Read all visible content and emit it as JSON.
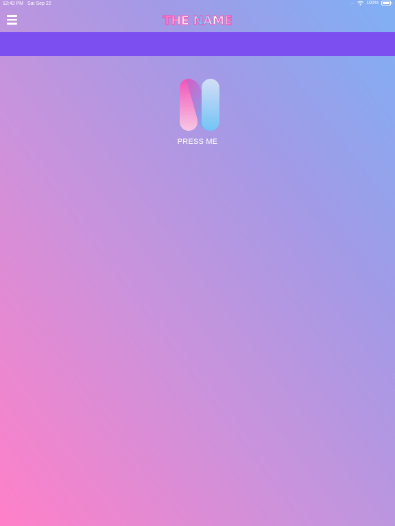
{
  "status_bar": {
    "time": "12:42 PM",
    "date": "Sat Sep 22",
    "signal": "....",
    "battery": "100%"
  },
  "nav": {
    "menu_icon": "hamburger-menu-icon",
    "logo_text": "THE NAME"
  },
  "main": {
    "logo_icon": "n-logo-icon",
    "button_label": "PRESS ME"
  },
  "colors": {
    "banner": "#7b4ff0",
    "gradient_top": "#7fb0f5",
    "gradient_bottom": "#ff80c8"
  }
}
